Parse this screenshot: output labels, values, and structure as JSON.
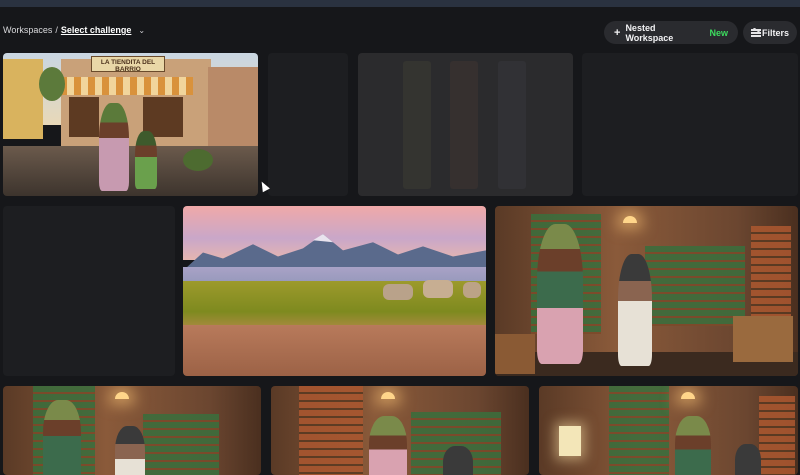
{
  "breadcrumb": {
    "root": "Workspaces",
    "separator": "/",
    "current": "Select challenge"
  },
  "header": {
    "nested_label": "Nested Workspace",
    "nested_badge": "New",
    "filters_label": "Filters"
  },
  "gallery": {
    "store_sign": "LA TIENDITA DEL BARRIO"
  },
  "colors": {
    "background": "#16171a",
    "button_bg": "#2a2b2f",
    "badge_green": "#3ddc5f"
  }
}
